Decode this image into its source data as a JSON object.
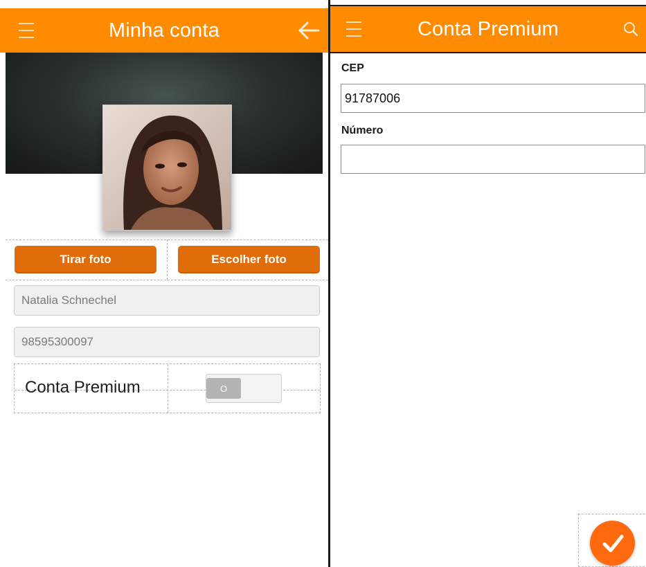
{
  "left_screen": {
    "appbar": {
      "title": "Minha conta",
      "menu_icon": "hamburger-icon",
      "back_icon": "arrow-left-icon"
    },
    "profile": {
      "photo": "profile-photo"
    },
    "buttons": {
      "take_photo": "Tirar foto",
      "choose_photo": "Escolher foto"
    },
    "fields": {
      "name": "Natalia Schnechel",
      "phone": "98595300097"
    },
    "premium": {
      "label": "Conta Premium",
      "toggle_text": "O",
      "enabled": false
    }
  },
  "right_screen": {
    "appbar": {
      "title": "Conta Premium",
      "menu_icon": "hamburger-icon",
      "search_icon": "search-icon"
    },
    "form": {
      "cep_label": "CEP",
      "cep_value": "91787006",
      "numero_label": "Número",
      "numero_value": ""
    },
    "fab_icon": "checkmark-icon"
  },
  "colors": {
    "appbar": "#ff8b00",
    "button": "#e06c0a",
    "fab": "#ff6a0f"
  }
}
